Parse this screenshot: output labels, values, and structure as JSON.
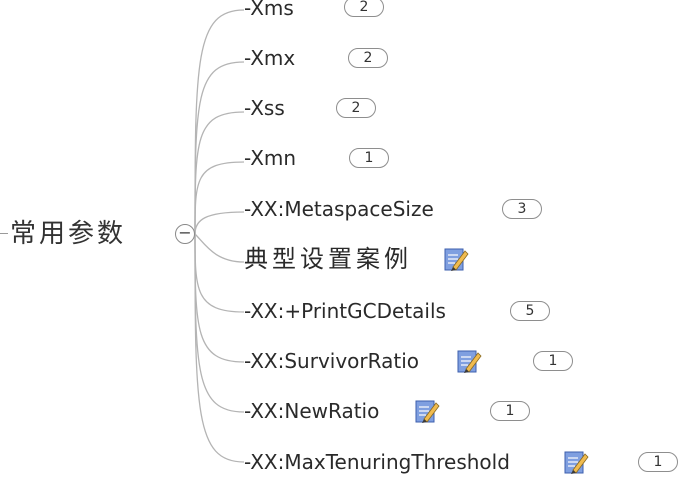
{
  "root": {
    "label": "常用参数",
    "collapse_symbol": "−"
  },
  "children": [
    {
      "label": "-Xms",
      "badge": "2",
      "has_note": false
    },
    {
      "label": "-Xmx",
      "badge": "2",
      "has_note": false
    },
    {
      "label": "-Xss",
      "badge": "2",
      "has_note": false
    },
    {
      "label": "-Xmn",
      "badge": "1",
      "has_note": false
    },
    {
      "label": "-XX:MetaspaceSize",
      "badge": "3",
      "has_note": false
    },
    {
      "label": "典型设置案例",
      "badge": "",
      "has_note": true
    },
    {
      "label": "-XX:+PrintGCDetails",
      "badge": "5",
      "has_note": false
    },
    {
      "label": "-XX:SurvivorRatio",
      "badge": "1",
      "has_note": true
    },
    {
      "label": "-XX:NewRatio",
      "badge": "1",
      "has_note": true
    },
    {
      "label": "-XX:MaxTenuringThreshold",
      "badge": "1",
      "has_note": true
    }
  ],
  "icons": {
    "note": "note-pencil-icon",
    "collapse": "collapse-minus-icon"
  },
  "colors": {
    "connector": "#b4b4b4",
    "badge_border": "#8e8e8e",
    "text": "#2a2a2a",
    "note_paper": "#6f8fd6",
    "pencil": "#e8b34a"
  }
}
